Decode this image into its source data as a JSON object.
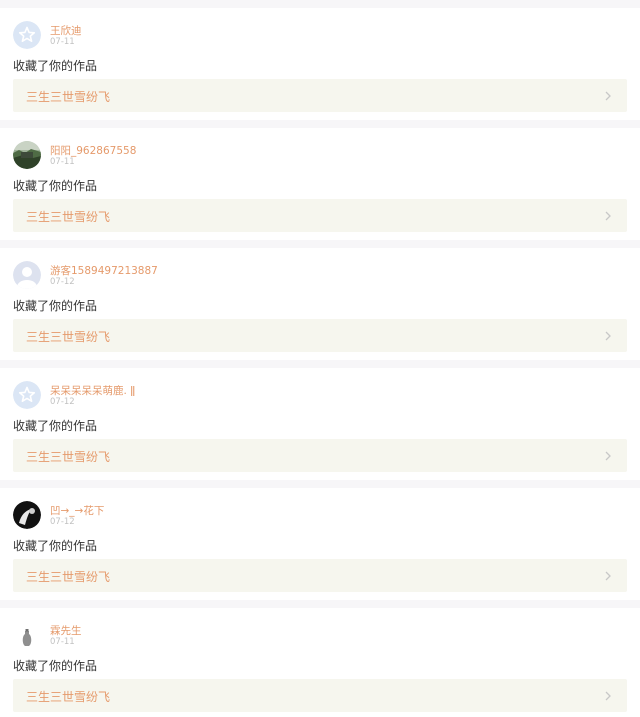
{
  "notifications": [
    {
      "avatar": "default-star-avatar-icon",
      "username": "王欣迪",
      "date": "07-11",
      "action": "收藏了你的作品",
      "work_title": "三生三世雪纷飞"
    },
    {
      "avatar": "photo-avatar-landscape",
      "username": "阳阳_962867558",
      "date": "07-11",
      "action": "收藏了你的作品",
      "work_title": "三生三世雪纷飞"
    },
    {
      "avatar": "default-person-avatar-icon",
      "username": "游客1589497213887",
      "date": "07-12",
      "action": "收藏了你的作品",
      "work_title": "三生三世雪纷飞"
    },
    {
      "avatar": "default-star-avatar-icon",
      "username": "呆呆呆呆呆萌鹿. ǁ",
      "date": "07-12",
      "action": "收藏了你的作品",
      "work_title": "三生三世雪纷飞"
    },
    {
      "avatar": "photo-avatar-dark",
      "username": "凹→_→花下",
      "date": "07-12",
      "action": "收藏了你的作品",
      "work_title": "三生三世雪纷飞"
    },
    {
      "avatar": "photo-avatar-vase",
      "username": "霖先生",
      "date": "07-11",
      "action": "收藏了你的作品",
      "work_title": "三生三世雪纷飞"
    }
  ],
  "colors": {
    "accent": "#e59a6b",
    "page_bg": "#f7f6f8",
    "work_bg": "#f6f6ee",
    "date": "#c2c2c2",
    "text": "#333333"
  }
}
